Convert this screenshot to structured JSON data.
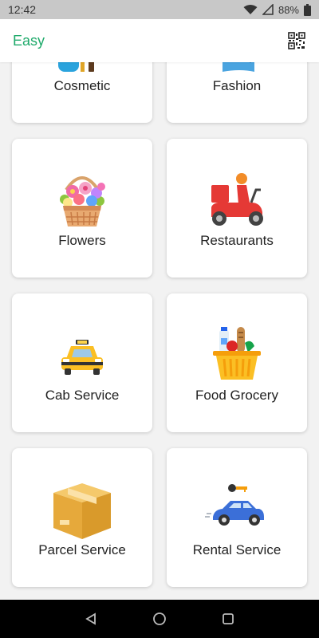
{
  "status_bar": {
    "time": "12:42",
    "battery": "88%"
  },
  "app_bar": {
    "title": "Easy"
  },
  "categories": [
    {
      "label": "Cosmetic",
      "icon": "cosmetic-icon"
    },
    {
      "label": "Fashion",
      "icon": "fashion-icon"
    },
    {
      "label": "Flowers",
      "icon": "flower-basket-icon"
    },
    {
      "label": "Restaurants",
      "icon": "delivery-scooter-icon"
    },
    {
      "label": "Cab Service",
      "icon": "taxi-icon"
    },
    {
      "label": "Food Grocery",
      "icon": "grocery-basket-icon"
    },
    {
      "label": "Parcel Service",
      "icon": "parcel-box-icon"
    },
    {
      "label": "Rental Service",
      "icon": "rental-car-icon"
    }
  ],
  "colors": {
    "accent": "#1faa6b",
    "background": "#f2f2f2",
    "card": "#ffffff"
  }
}
